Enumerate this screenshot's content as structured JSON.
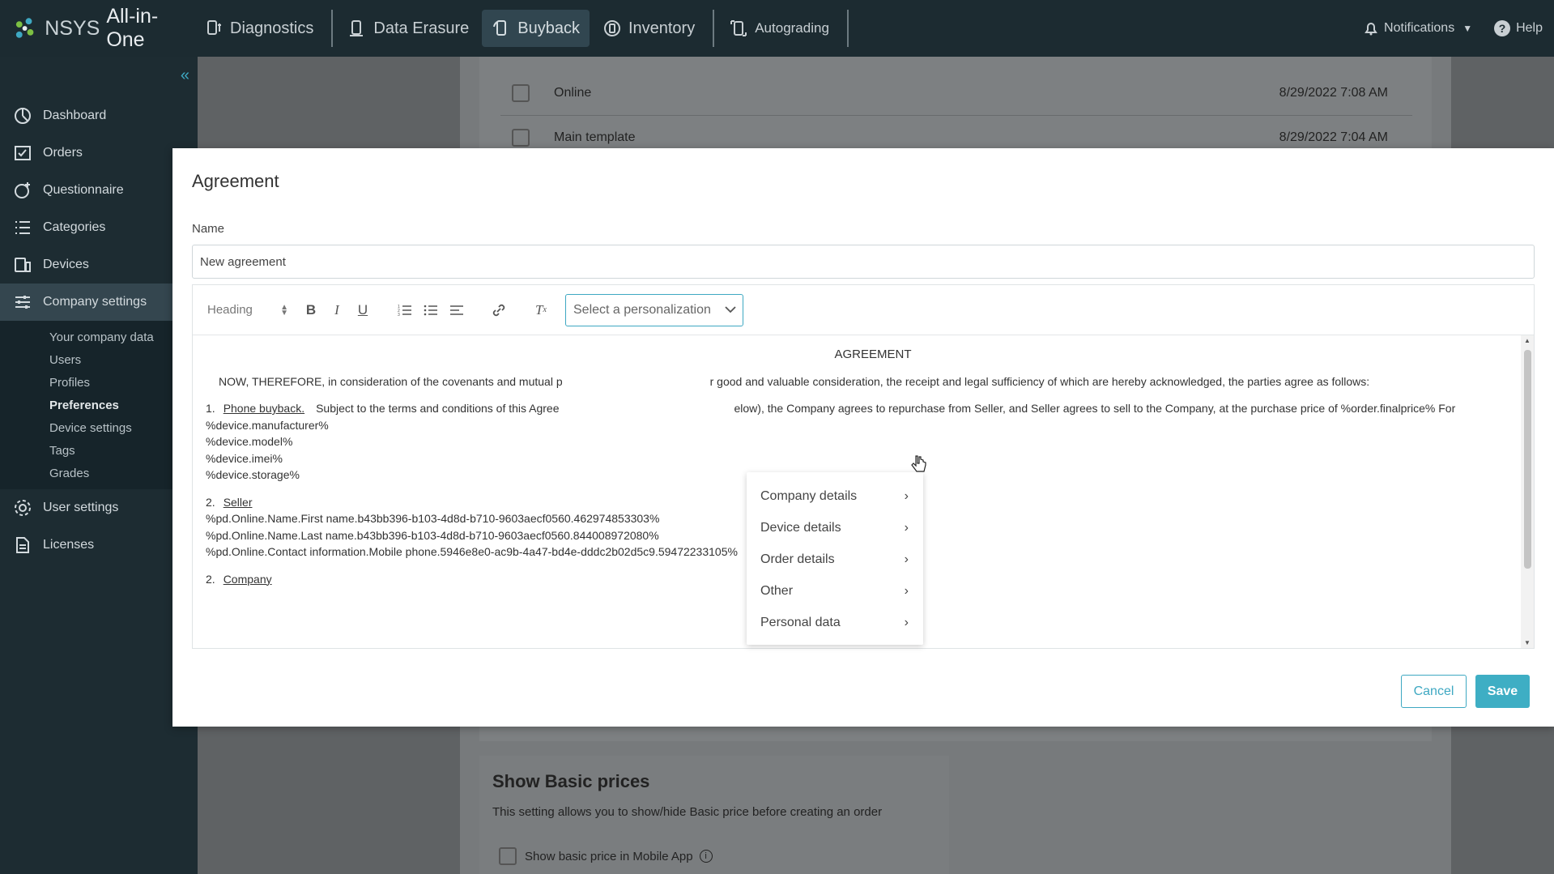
{
  "brand": {
    "name_part1": "NSYS",
    "name_part2": "All-in-One"
  },
  "nav": {
    "tabs": [
      {
        "label": "Diagnostics",
        "icon": "diagnostics-icon"
      },
      {
        "label": "Data Erasure",
        "icon": "data-erasure-icon"
      },
      {
        "label": "Buyback",
        "icon": "buyback-icon",
        "active": true
      },
      {
        "label": "Inventory",
        "icon": "inventory-icon"
      },
      {
        "label": "Autograding",
        "icon": "autograding-icon"
      }
    ],
    "notifications": "Notifications",
    "help": "Help"
  },
  "sidebar": {
    "items": [
      {
        "label": "Dashboard"
      },
      {
        "label": "Orders"
      },
      {
        "label": "Questionnaire"
      },
      {
        "label": "Categories"
      },
      {
        "label": "Devices"
      },
      {
        "label": "Company settings"
      }
    ],
    "subitems": [
      "Your company data",
      "Users",
      "Profiles",
      "Preferences",
      "Device settings",
      "Tags",
      "Grades"
    ],
    "bottom_items": [
      {
        "label": "User settings"
      },
      {
        "label": "Licenses"
      }
    ]
  },
  "background": {
    "rows": [
      {
        "name": "Online",
        "date": "8/29/2022 7:08 AM"
      },
      {
        "name": "Main template",
        "date": "8/29/2022 7:04 AM"
      }
    ],
    "basic_prices": {
      "title": "Show Basic prices",
      "desc": "This setting allows you to show/hide Basic price before creating an order",
      "checkbox_label": "Show basic price in Mobile App"
    }
  },
  "modal": {
    "title": "Agreement",
    "name_label": "Name",
    "name_value": "New agreement",
    "toolbar": {
      "heading": "Heading",
      "personalization_placeholder": "Select a personalization"
    },
    "content": {
      "title": "AGREEMENT",
      "para1_a": "NOW, THEREFORE, in consideration of the covenants and mutual p",
      "para1_b": "r good and valuable consideration, the receipt and legal sufficiency of which are hereby acknowledged, the parties agree as follows:",
      "item1_num": "1.",
      "item1_title": "Phone buyback.",
      "item1_text_a": "Subject to the terms and conditions of this Agree",
      "item1_text_b": "elow), the Company agrees to repurchase from Seller, and Seller agrees to sell to the Company, at the purchase price of %order.finalprice% For",
      "device_lines": [
        "%device.manufacturer%",
        "%device.model%",
        "%device.imei%",
        "%device.storage%"
      ],
      "item2_num": "2.",
      "item2_title": "Seller",
      "seller_lines": [
        "%pd.Online.Name.First name.b43bb396-b103-4d8d-b710-9603aecf0560.462974853303%",
        "%pd.Online.Name.Last name.b43bb396-b103-4d8d-b710-9603aecf0560.844008972080%",
        "%pd.Online.Contact information.Mobile phone.5946e8e0-ac9b-4a47-bd4e-dddc2b02d5c9.59472233105%"
      ],
      "item3_num": "2.",
      "item3_title": "Company"
    },
    "dropdown": [
      "Company details",
      "Device details",
      "Order details",
      "Other",
      "Personal data"
    ],
    "cancel": "Cancel",
    "save": "Save"
  },
  "colors": {
    "accent": "#3eaec4",
    "nav_bg": "#1c2b31",
    "sidebar_bg": "#1d2c32"
  }
}
